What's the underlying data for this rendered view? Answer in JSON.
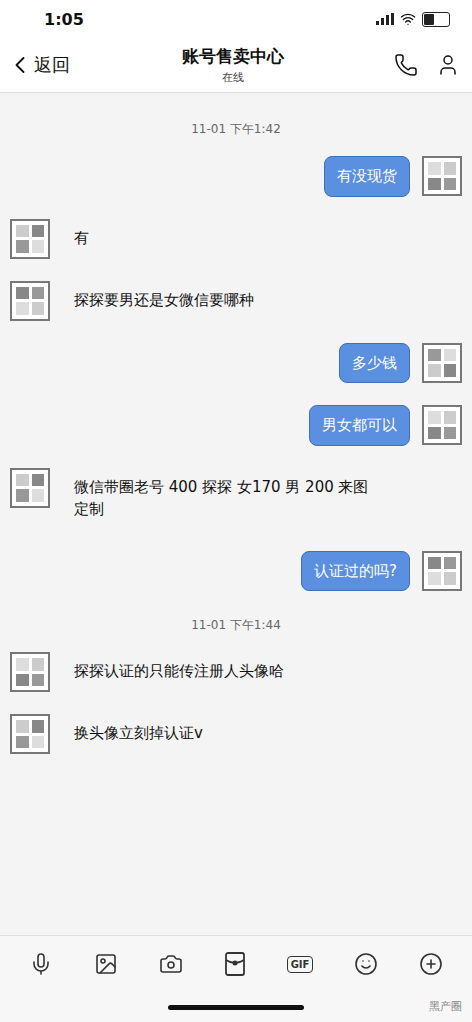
{
  "status_bar": {
    "time": "1:05",
    "battery": {
      "level": 0.4
    }
  },
  "nav": {
    "back": "返回",
    "title": "账号售卖中心",
    "subtitle": "在线"
  },
  "messages": [
    {
      "kind": "time",
      "text": "11-01 下午1:42"
    },
    {
      "kind": "message",
      "from": "me",
      "text": "有没现货"
    },
    {
      "kind": "message",
      "from": "them",
      "text": "有"
    },
    {
      "kind": "message",
      "from": "them",
      "text": "探探要男还是女微信要哪种"
    },
    {
      "kind": "message",
      "from": "me",
      "text": "多少钱"
    },
    {
      "kind": "message",
      "from": "me",
      "text": "男女都可以"
    },
    {
      "kind": "message",
      "from": "them",
      "text": "微信带圈老号 400 探探 女170 男 200 来图定制"
    },
    {
      "kind": "message",
      "from": "me",
      "text": "认证过的吗?"
    },
    {
      "kind": "time",
      "text": "11-01 下午1:44"
    },
    {
      "kind": "message",
      "from": "them",
      "text": "探探认证的只能传注册人头像哈"
    },
    {
      "kind": "message",
      "from": "them",
      "text": "换头像立刻掉认证v"
    }
  ],
  "toolbar": {
    "gif": "GIF"
  },
  "watermark": "黑产圈"
}
